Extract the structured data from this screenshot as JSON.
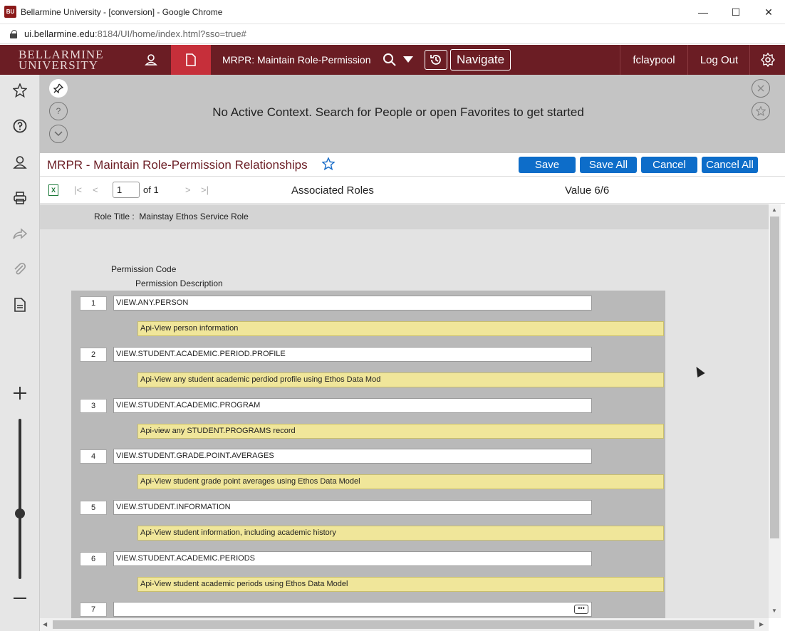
{
  "window": {
    "app_icon": "BU",
    "title": "Bellarmine University - [conversion] - Google Chrome",
    "minimize": "—",
    "maximize": "☐",
    "close": "✕"
  },
  "address": {
    "host": "ui.bellarmine.edu",
    "rest": ":8184/UI/home/index.html?sso=true#"
  },
  "header": {
    "logo_line1": "BELLARMINE",
    "logo_line2": "UNIVERSITY",
    "form_title": "MRPR: Maintain Role-Permission",
    "navigate": "Navigate",
    "user": "fclaypool",
    "logout": "Log Out"
  },
  "context": {
    "message": "No Active Context. Search for People or open Favorites to get started"
  },
  "form": {
    "title": "MRPR - Maintain Role-Permission Relationships",
    "buttons": {
      "save": "Save",
      "save_all": "Save All",
      "cancel": "Cancel",
      "cancel_all": "Cancel All"
    },
    "page": "1",
    "of": "of 1",
    "section": "Associated Roles",
    "value_count": "Value 6/6",
    "role_title_label": "Role Title :",
    "role_title": "Mainstay Ethos Service Role",
    "col_code": "Permission Code",
    "col_desc": "Permission Description"
  },
  "rows": [
    {
      "num": "1",
      "code": "VIEW.ANY.PERSON",
      "desc": "Api-View person information"
    },
    {
      "num": "2",
      "code": "VIEW.STUDENT.ACADEMIC.PERIOD.PROFILE",
      "desc": "Api-View any student academic perdiod profile using Ethos Data Mod"
    },
    {
      "num": "3",
      "code": "VIEW.STUDENT.ACADEMIC.PROGRAM",
      "desc": "Api-view any STUDENT.PROGRAMS record"
    },
    {
      "num": "4",
      "code": "VIEW.STUDENT.GRADE.POINT.AVERAGES",
      "desc": "Api-View student grade point averages using Ethos Data Model"
    },
    {
      "num": "5",
      "code": "VIEW.STUDENT.INFORMATION",
      "desc": "Api-View student information, including academic history"
    },
    {
      "num": "6",
      "code": "VIEW.STUDENT.ACADEMIC.PERIODS",
      "desc": "Api-View student academic periods using Ethos Data Model"
    },
    {
      "num": "7",
      "code": "",
      "desc": ""
    }
  ],
  "colors": {
    "header": "#6b1d24",
    "active_tab": "#c62f3a",
    "button": "#0d6dc9",
    "desc_fill": "#f0e69a"
  }
}
